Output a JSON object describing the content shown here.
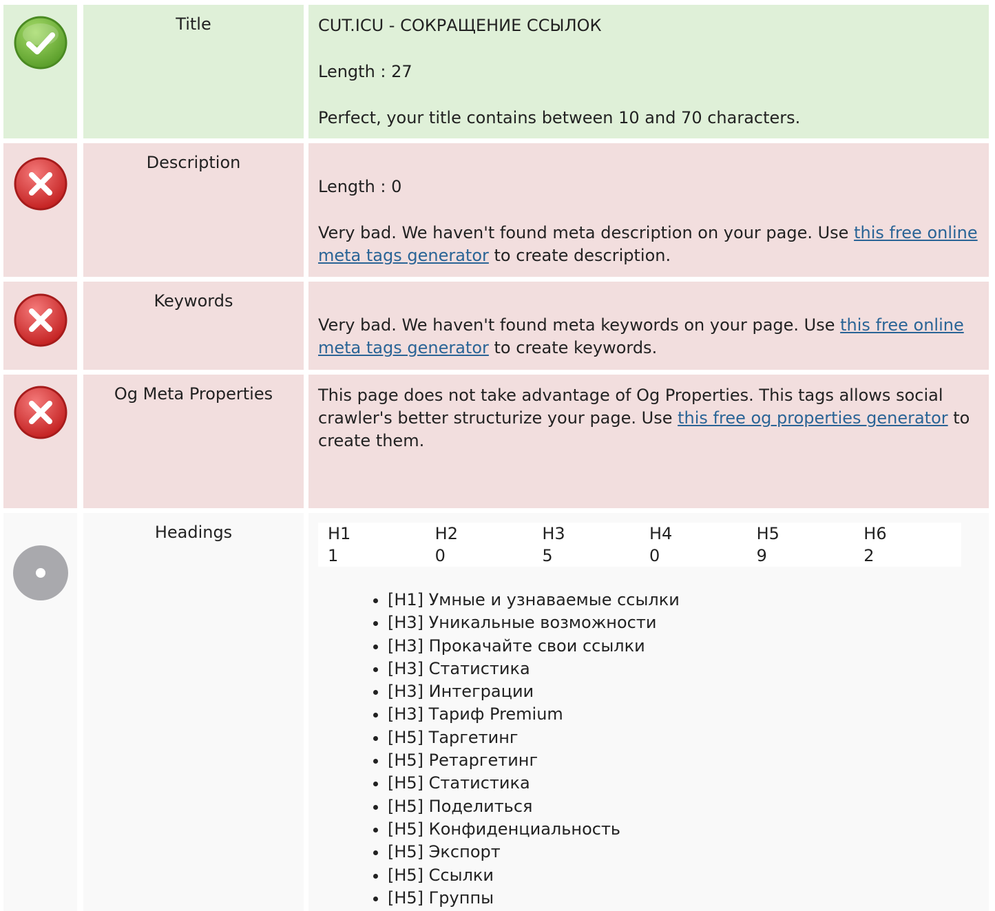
{
  "rows": {
    "title": {
      "label": "Title",
      "value": "CUT.ICU - СОКРАЩЕНИЕ ССЫЛОК",
      "length": "Length : 27",
      "message": "Perfect, your title contains between 10 and 70 characters.",
      "status": "ok"
    },
    "description": {
      "label": "Description",
      "length": "Length : 0",
      "message_before": "Very bad. We haven't found meta description on your page. Use ",
      "link": "this free online meta tags generator",
      "message_after": " to create description.",
      "status": "bad"
    },
    "keywords": {
      "label": "Keywords",
      "message_before": "Very bad. We haven't found meta keywords on your page. Use ",
      "link": "this free online meta tags generator",
      "message_after": " to create keywords.",
      "status": "bad"
    },
    "og": {
      "label": "Og Meta Properties",
      "message_before": "This page does not take advantage of Og Properties. This tags allows social crawler's better structurize your page. Use ",
      "link": "this free og properties generator",
      "message_after": " to create them.",
      "status": "bad"
    },
    "headings": {
      "label": "Heading​s",
      "table_headers": [
        "H1",
        "H2",
        "H3",
        "H4",
        "H5",
        "H6"
      ],
      "table_values": [
        "1",
        "0",
        "5",
        "0",
        "9",
        "2"
      ],
      "items": [
        "[H1] Умные и узнаваемые ссылки",
        "[H3] Уникальные возможности",
        "[H3] Прокачайте свои ссылки",
        "[H3] Статистика",
        "[H3] Интеграции",
        "[H3] Тариф Premium",
        "[H5] Таргетинг",
        "[H5] Ретаргетинг",
        "[H5] Статистика",
        "[H5] Поделиться",
        "[H5] Конфиденциальность",
        "[H5] Экспорт",
        "[H5] Ссылки",
        "[H5] Группы"
      ],
      "status": "neutral"
    }
  },
  "colors": {
    "ok_bg": "#dff0d8",
    "bad_bg": "#f2dede",
    "neutral_bg": "#f9f9f9",
    "link": "#2a6496",
    "ok_icon": "#7cc242",
    "bad_icon": "#e23c3c",
    "neutral_icon": "#a9a9ad"
  },
  "icons": {
    "ok": "check-circle-icon",
    "bad": "error-x-circle-icon",
    "neutral": "neutral-dot-circle-icon"
  }
}
